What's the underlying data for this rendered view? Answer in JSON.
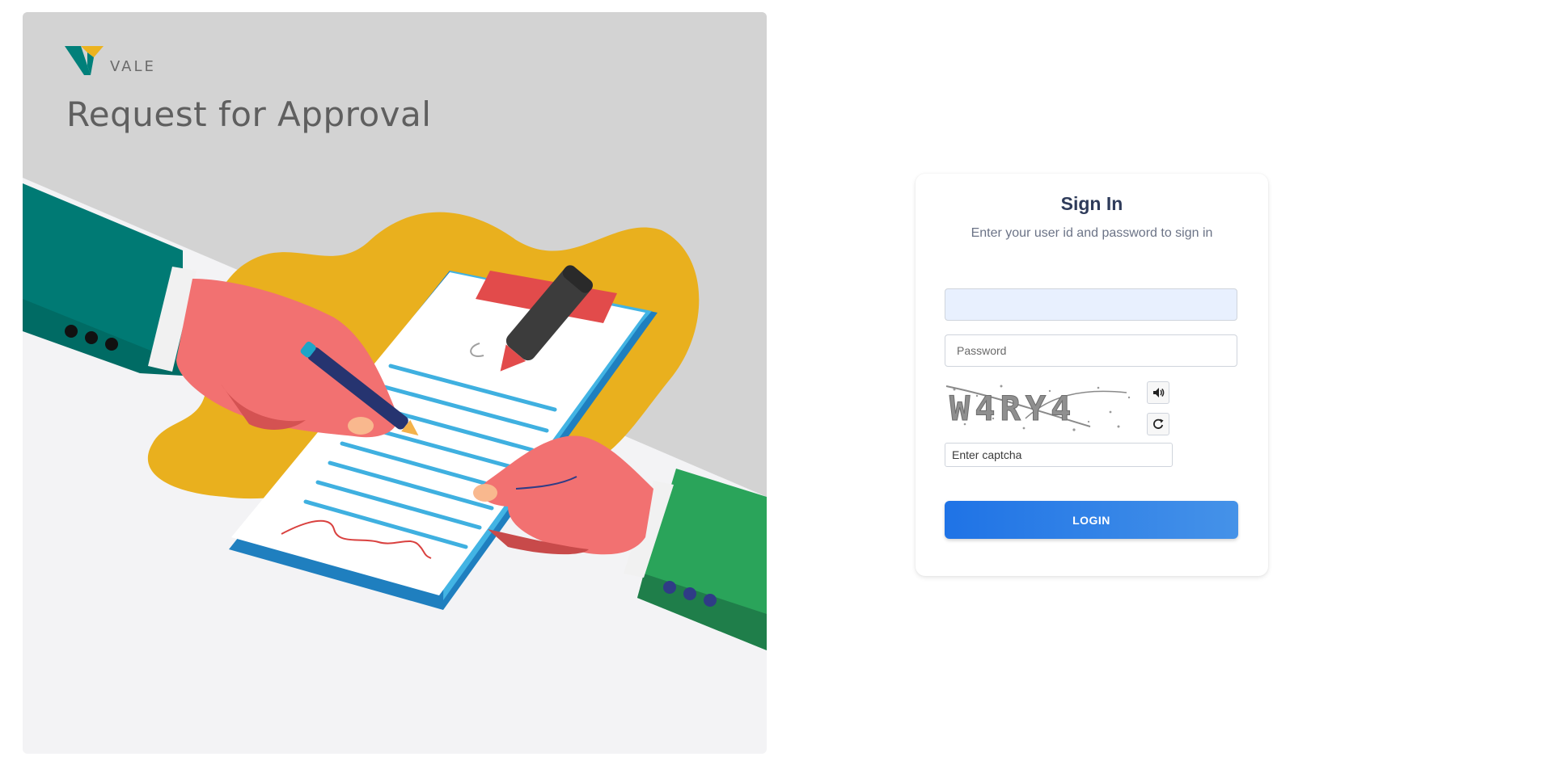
{
  "hero": {
    "brand": "VALE",
    "title": "Request for Approval"
  },
  "signin": {
    "title": "Sign In",
    "subtitle": "Enter your user id and password to sign in",
    "userid_value": "",
    "password_placeholder": "Password",
    "captcha_text": "W4RY4",
    "captcha_placeholder": "Enter captcha",
    "login_label": "LOGIN"
  },
  "icons": {
    "audio": "speaker-icon",
    "refresh": "refresh-icon"
  },
  "colors": {
    "brand_teal": "#00807a",
    "brand_yellow": "#ecb31f",
    "primary_button": "#2b7de9",
    "title_text": "#2e3b5a"
  }
}
